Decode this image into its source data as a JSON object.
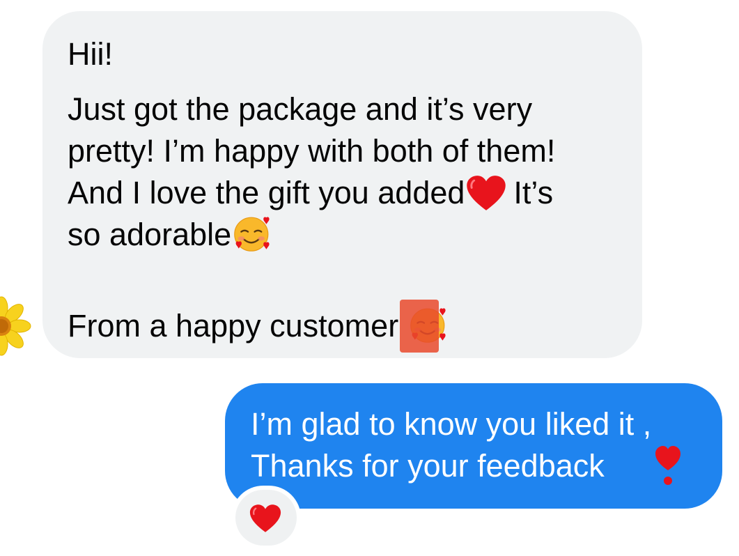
{
  "incoming_message": {
    "greeting": "Hii!",
    "body_lines": [
      "Just got the package and it’s very",
      "pretty! I’m happy with both of them!",
      "And I love the gift you added",
      "It’s",
      "so adorable"
    ],
    "signoff": "From a happy customer",
    "emojis": [
      "red-heart",
      "smiling-face-with-hearts"
    ],
    "reaction": "sunflower",
    "bubble_color": "#f0f2f3"
  },
  "outgoing_message": {
    "lines": [
      "I’m glad to know you liked it ,",
      "Thanks for your feedback"
    ],
    "emoji": "heart-exclamation",
    "bubble_color": "#1f84ef",
    "reaction": "red-heart"
  }
}
